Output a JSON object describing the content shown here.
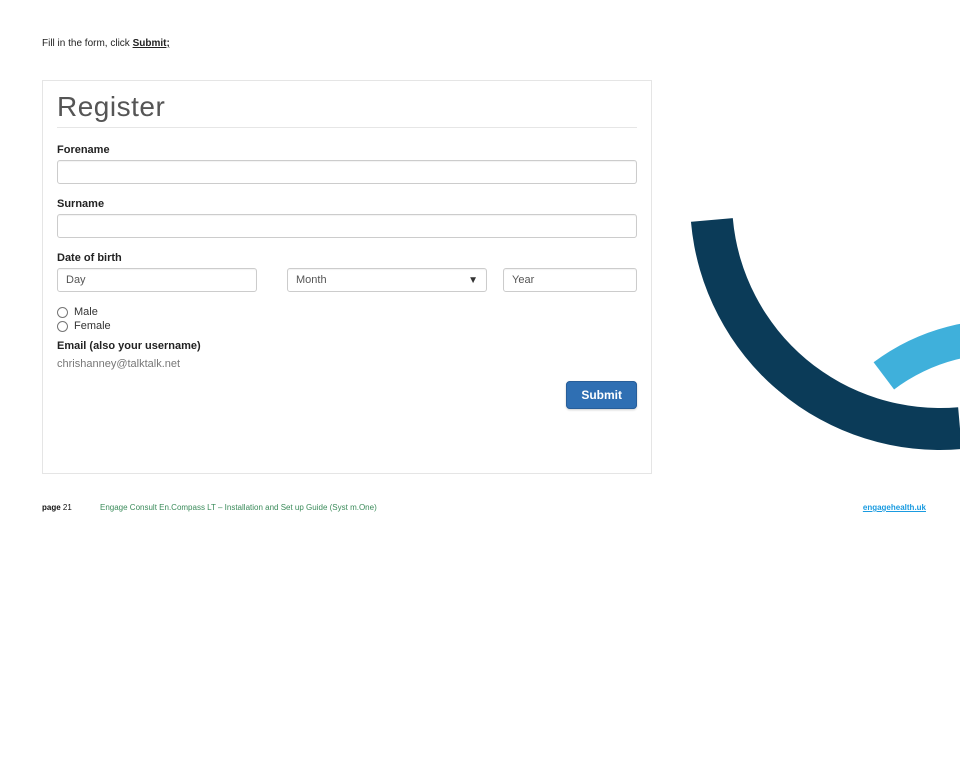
{
  "instruction": {
    "prefix": "Fill in the form, click ",
    "bold": "Submit;"
  },
  "form": {
    "title": "Register",
    "labels": {
      "forename": "Forename",
      "surname": "Surname",
      "dob": "Date of birth",
      "male": "Male",
      "female": "Female",
      "email": "Email (also your username)"
    },
    "dob": {
      "day": "Day",
      "month": "Month",
      "year": "Year"
    },
    "email_value": "chrishanney@talktalk.net",
    "submit": "Submit"
  },
  "footer": {
    "page_label": "page ",
    "page_number": "21",
    "doc_title": "Engage Consult En.Compass LT – Installation and Set up Guide (Syst m.One)",
    "link": "engagehealth.uk"
  }
}
